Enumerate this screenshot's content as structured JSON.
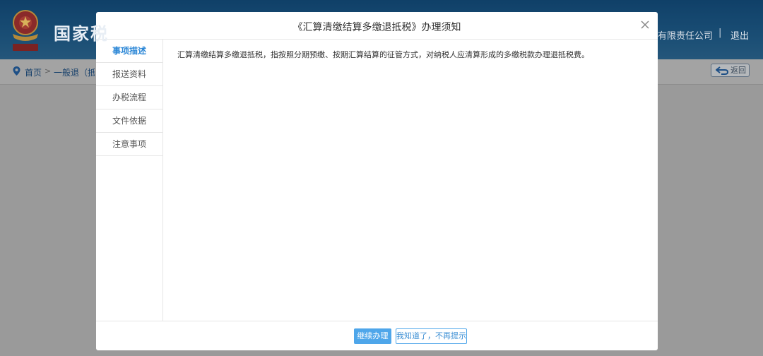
{
  "header": {
    "site_title": "国家税",
    "company": "有限责任公司",
    "separator": "|",
    "logout_label": "退出"
  },
  "breadcrumb": {
    "home_label": "首页",
    "arrow": ">",
    "current_label": "一般退（抵"
  },
  "back_button": {
    "label": "返回"
  },
  "modal": {
    "title": "《汇算清缴结算多缴退抵税》办理须知",
    "tabs": [
      {
        "label": "事项描述",
        "active": true
      },
      {
        "label": "报送资料",
        "active": false
      },
      {
        "label": "办税流程",
        "active": false
      },
      {
        "label": "文件依据",
        "active": false
      },
      {
        "label": "注意事项",
        "active": false
      }
    ],
    "content": "汇算清缴结算多缴退抵税，指按照分期预缴、按期汇算结算的征管方式，对纳税人应清算形成的多缴税款办理退抵税费。",
    "continue_label": "继续办理",
    "dismiss_label": "我知道了，不再提示"
  },
  "colors": {
    "accent": "#4ea6ea",
    "active_tab": "#2a86d6",
    "overlay": "#9a9a9a"
  },
  "icons": [
    "emblem-icon",
    "location-pin-icon",
    "return-arrow-icon",
    "close-icon"
  ]
}
